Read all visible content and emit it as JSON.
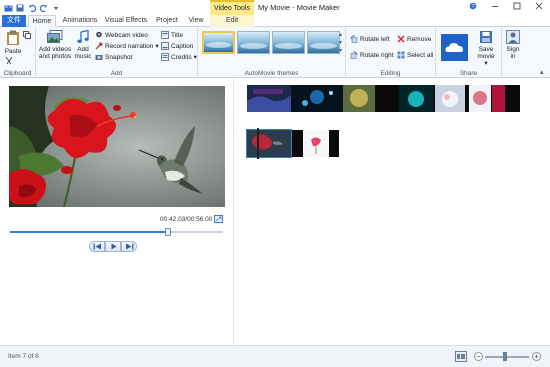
{
  "window": {
    "title": "My Movie - Movie Maker",
    "context_tab_group": "Video Tools"
  },
  "quick_access": {
    "icons": [
      "save-icon",
      "undo-icon",
      "redo-icon",
      "customize-qat-icon"
    ]
  },
  "tabs": {
    "file": "文件",
    "home": "Home",
    "animations": "Animations",
    "visual_effects": "Visual Effects",
    "project": "Project",
    "view": "View",
    "edit": "Edit",
    "active": "Home"
  },
  "ribbon": {
    "clipboard": {
      "label": "Clipboard",
      "paste": "Paste"
    },
    "add": {
      "label": "Add",
      "add_videos_photos_line1": "Add videos",
      "add_videos_photos_line2": "and photos",
      "add_music_line1": "Add",
      "add_music_line2": "music",
      "webcam_video": "Webcam video",
      "record_narration": "Record narration",
      "snapshot": "Snapshot",
      "title": "Title",
      "caption": "Caption",
      "credits": "Credits"
    },
    "automovie": {
      "label": "AutoMovie themes"
    },
    "editing": {
      "label": "Editing",
      "rotate_left": "Rotate left",
      "rotate_right": "Rotate right",
      "remove": "Remove",
      "select_all": "Select all"
    },
    "share": {
      "label": "Share",
      "save_movie_line1": "Save",
      "save_movie_line2": "movie",
      "sign_in_line1": "Sign",
      "sign_in_line2": "in"
    }
  },
  "preview": {
    "timecode": "00:42.03/00:56.00",
    "position_fraction": 0.75
  },
  "status": {
    "item_text": "Item 7 of 8"
  },
  "colors": {
    "accent": "#2a6fd6",
    "context_tab": "#fbe98a",
    "selection": "#3a7bd5"
  }
}
